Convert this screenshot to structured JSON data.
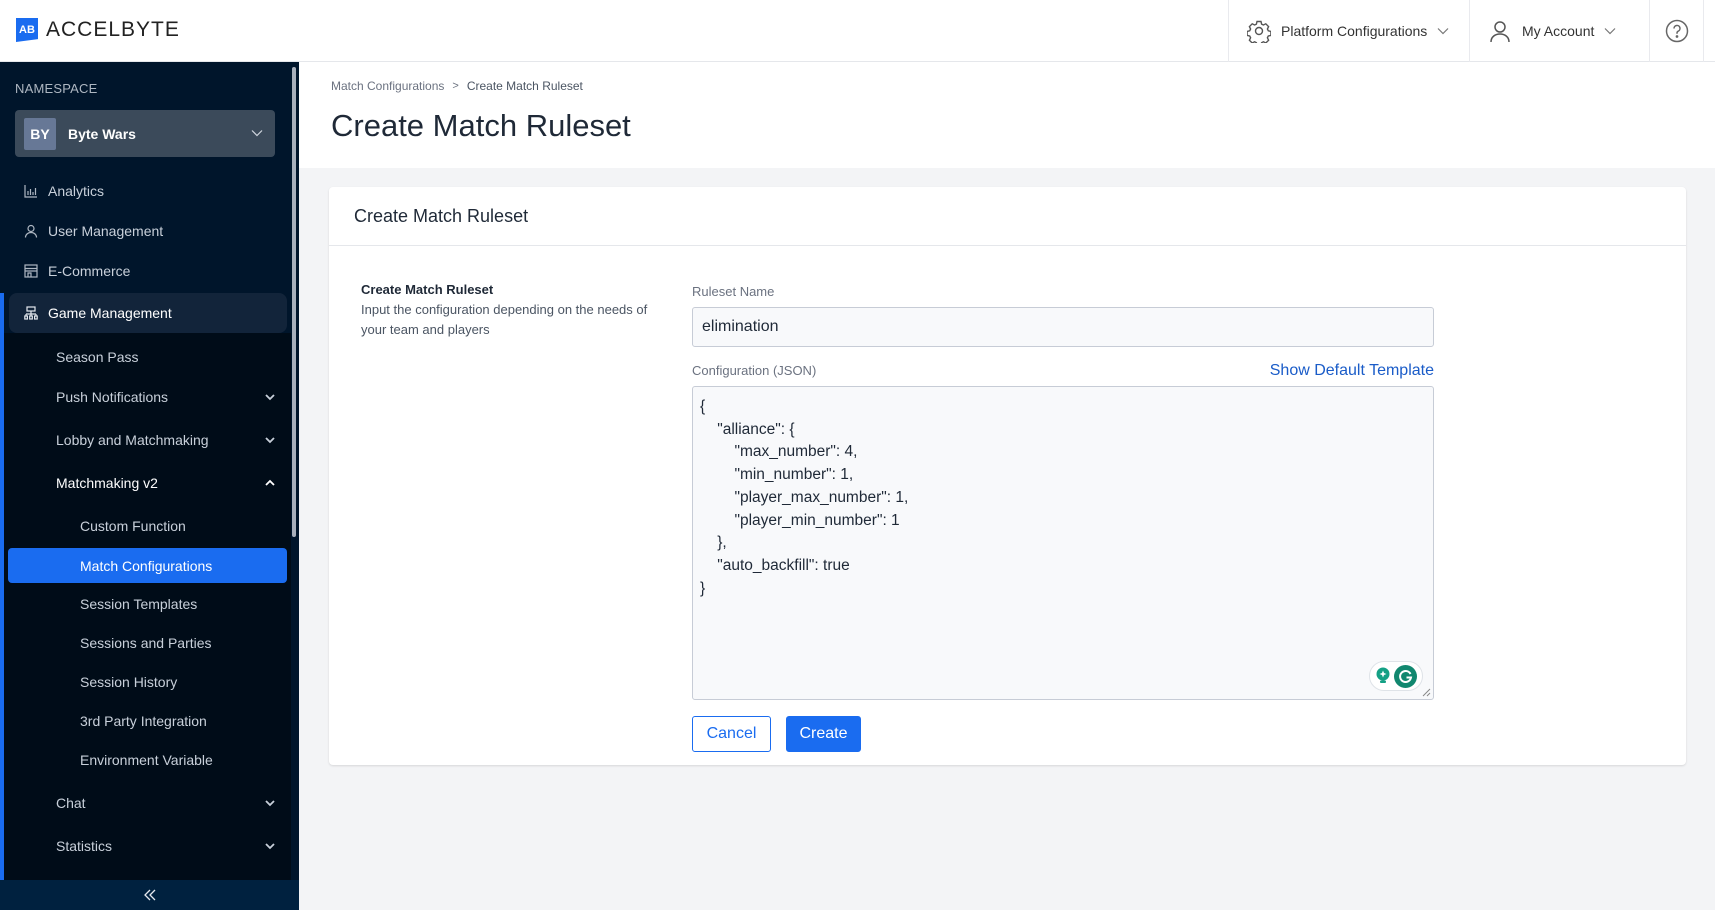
{
  "header": {
    "logo_mark": "AB",
    "logo_text": "ACCELBYTE",
    "platform_configurations": "Platform Configurations",
    "my_account": "My Account",
    "help_icon": "help-circle-icon"
  },
  "sidebar": {
    "namespace_label": "NAMESPACE",
    "namespace": {
      "badge": "BY",
      "name": "Byte Wars"
    },
    "items": [
      {
        "label": "Analytics",
        "icon": "bar-chart-icon"
      },
      {
        "label": "User Management",
        "icon": "user-icon"
      },
      {
        "label": "E-Commerce",
        "icon": "store-icon"
      },
      {
        "label": "Game Management",
        "icon": "hierarchy-icon",
        "expanded": true
      }
    ],
    "game_management_children": [
      {
        "label": "Season Pass"
      },
      {
        "label": "Push Notifications",
        "chevron": "down"
      },
      {
        "label": "Lobby and Matchmaking",
        "chevron": "down"
      },
      {
        "label": "Matchmaking v2",
        "chevron": "up",
        "expanded": true
      },
      {
        "label": "Chat",
        "chevron": "down"
      },
      {
        "label": "Statistics",
        "chevron": "down"
      }
    ],
    "matchmaking_v2_children": [
      {
        "label": "Custom Function"
      },
      {
        "label": "Match Configurations",
        "active": true
      },
      {
        "label": "Session Templates"
      },
      {
        "label": "Sessions and Parties"
      },
      {
        "label": "Session History"
      },
      {
        "label": "3rd Party Integration"
      },
      {
        "label": "Environment Variable"
      }
    ],
    "collapse_icon": "double-chevron-left-icon"
  },
  "page": {
    "breadcrumb": [
      "Match Configurations",
      "Create Match Ruleset"
    ],
    "title": "Create Match Ruleset"
  },
  "card": {
    "title": "Create Match Ruleset",
    "description_title": "Create Match Ruleset",
    "description": "Input the configuration depending on the needs of your team and players",
    "ruleset_name_label": "Ruleset Name",
    "ruleset_name_value": "elimination",
    "configuration_label": "Configuration (JSON)",
    "show_default_template": "Show Default Template",
    "configuration_value": "{\n    \"alliance\": {\n        \"max_number\": 4,\n        \"min_number\": 1,\n        \"player_max_number\": 1,\n        \"player_min_number\": 1\n    },\n    \"auto_backfill\": true\n}",
    "cancel_label": "Cancel",
    "create_label": "Create"
  },
  "colors": {
    "accent": "#1a6cf0",
    "sidebar_bg": "#00152b",
    "link": "#1a5cc8",
    "grammarly": "#11876f"
  }
}
